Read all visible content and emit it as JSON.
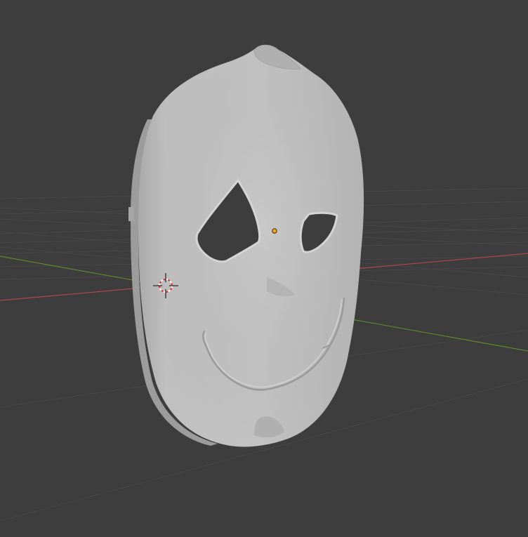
{
  "viewport": {
    "background": "#3d3d3d",
    "grid_color": "#464646",
    "x_axis_color": "#b0474f",
    "y_axis_color": "#5e8a2c"
  },
  "scene": {
    "object": "mask",
    "object_color": "#b9b9b9",
    "origin_color": "#f5a623"
  },
  "cursor": {
    "icon": "3d-cursor-icon"
  }
}
